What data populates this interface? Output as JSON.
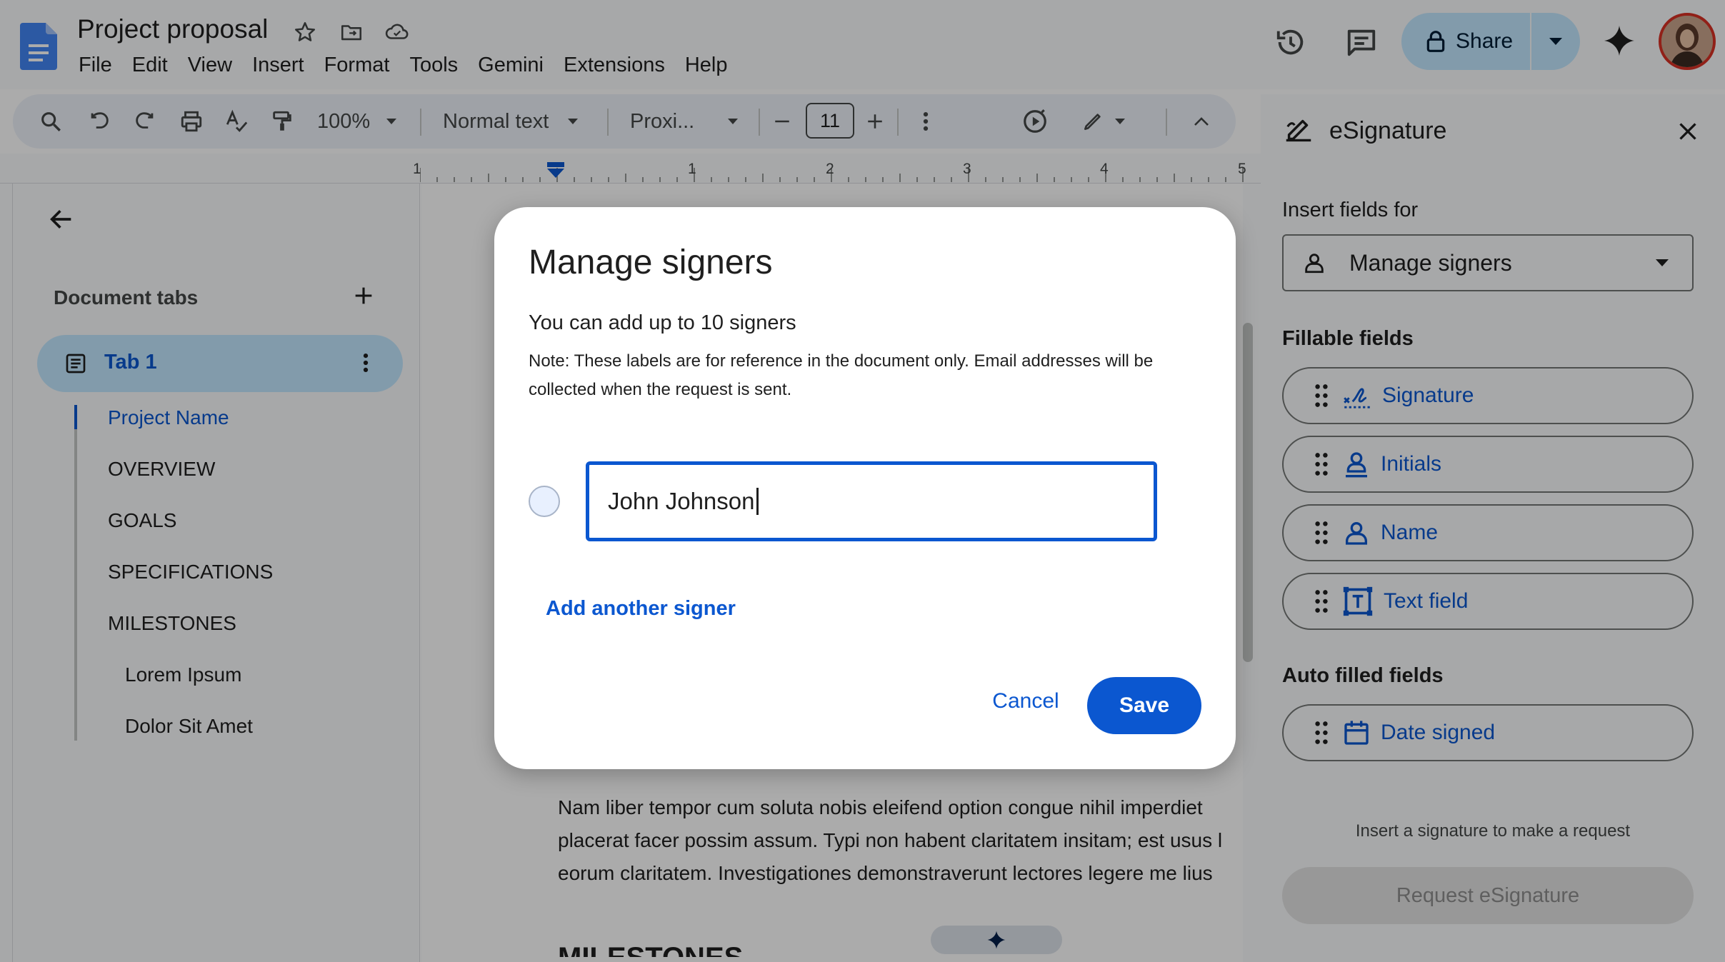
{
  "app": {
    "doc_title": "Project proposal",
    "menu": [
      "File",
      "Edit",
      "View",
      "Insert",
      "Format",
      "Tools",
      "Gemini",
      "Extensions",
      "Help"
    ],
    "share_label": "Share"
  },
  "toolbar": {
    "zoom": "100%",
    "style": "Normal text",
    "font": "Proxi...",
    "font_size": "11"
  },
  "ruler": {
    "labels": [
      "1",
      "1",
      "2",
      "3",
      "4",
      "5"
    ]
  },
  "outline": {
    "heading": "Document tabs",
    "tab_label": "Tab 1",
    "items": [
      "Project Name",
      "OVERVIEW",
      "GOALS",
      "SPECIFICATIONS",
      "MILESTONES"
    ],
    "subitems": [
      "Lorem Ipsum",
      "Dolor Sit Amet"
    ]
  },
  "document": {
    "lines": [
      "Nam liber tempor cum soluta nobis eleifend option congue nihil imperdiet",
      "placerat facer possim assum. Typi non habent claritatem insitam; est usus l",
      "eorum claritatem. Investigationes demonstraverunt lectores legere me lius"
    ],
    "heading_partial": "MILESTONES"
  },
  "side_panel": {
    "title": "eSignature",
    "insert_for_label": "Insert fields for",
    "select_value": "Manage signers",
    "fillable_heading": "Fillable fields",
    "fillable": [
      "Signature",
      "Initials",
      "Name",
      "Text field"
    ],
    "auto_heading": "Auto filled fields",
    "auto": [
      "Date signed"
    ],
    "note": "Insert a signature to make a request",
    "request_button": "Request eSignature"
  },
  "modal": {
    "title": "Manage signers",
    "subtitle": "You can add up to 10 signers",
    "note": "Note: These labels are for reference in the document only. Email addresses will be collected when the request is sent.",
    "signer_value": "John Johnson",
    "add_label": "Add another signer",
    "cancel_label": "Cancel",
    "save_label": "Save"
  },
  "colors": {
    "accent": "#0b57d0",
    "share_bg": "#c2e7ff",
    "tab_bg": "#c2e7ff",
    "doc_blue": "#4285f4"
  }
}
